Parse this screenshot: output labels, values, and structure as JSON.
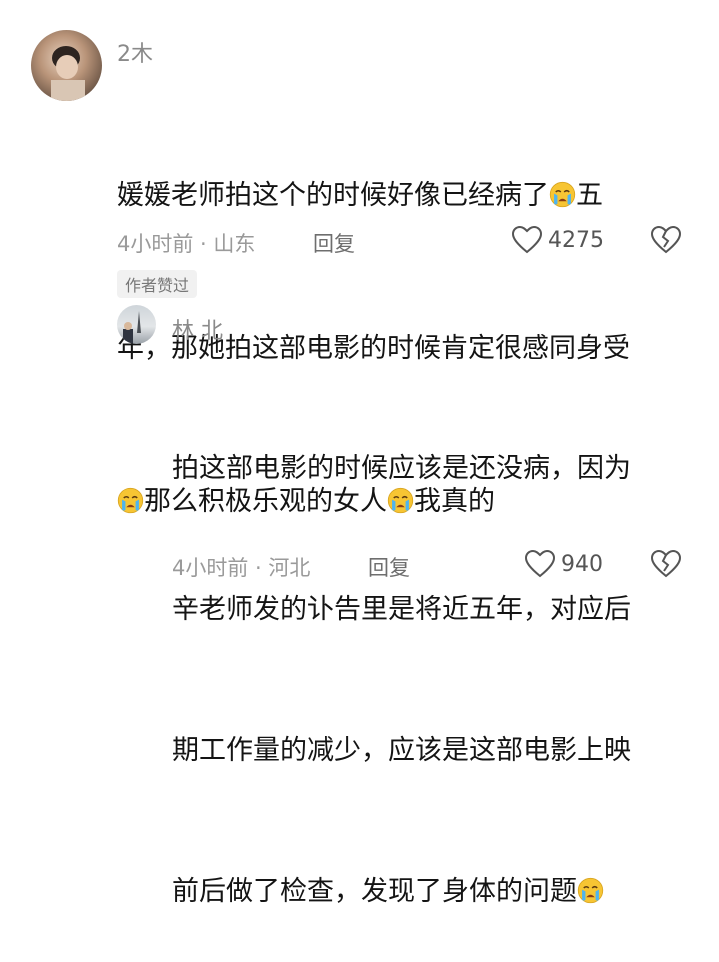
{
  "comment": {
    "username": "2木",
    "text_line1_a": "媛媛老师拍这个的时候好像已经病了",
    "text_line1_b": "五",
    "text_line2": "年，那她拍这部电影的时候肯定很感同身受",
    "text_line3_a": "那么积极乐观的女人",
    "text_line3_b": "我真的",
    "time_location": "4小时前 · 山东",
    "reply_label": "回复",
    "like_count": "4275",
    "badge": "作者赞过"
  },
  "reply": {
    "username": "林 北",
    "text_line1": "拍这部电影的时候应该是还没病，因为",
    "text_line2": "辛老师发的讣告里是将近五年，对应后",
    "text_line3": "期工作量的减少，应该是这部电影上映",
    "text_line4": "前后做了检查，发现了身体的问题",
    "time_location": "4小时前 · 河北",
    "reply_label": "回复",
    "like_count": "940"
  },
  "icons": {
    "crying_emoji": "crying-face-icon",
    "like": "heart-icon",
    "dislike": "broken-heart-icon"
  }
}
